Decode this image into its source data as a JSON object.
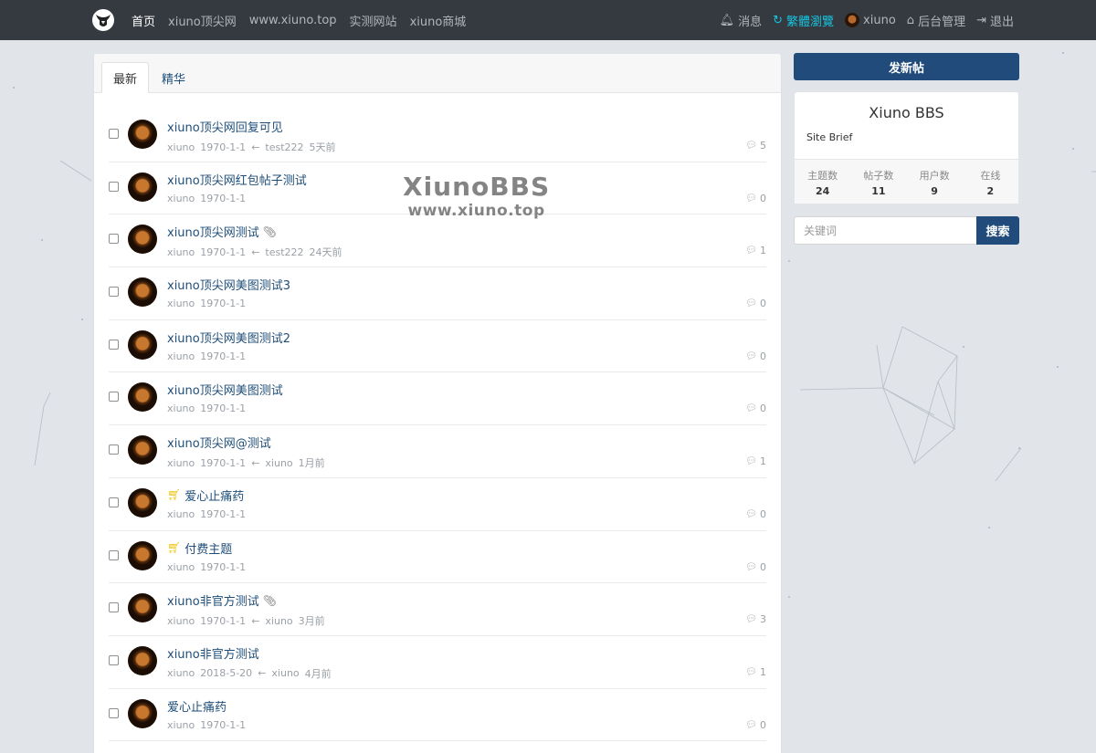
{
  "nav": {
    "left": [
      {
        "label": "首页",
        "active": true
      },
      {
        "label": "xiuno顶尖网",
        "active": false
      },
      {
        "label": "www.xiuno.top",
        "active": false
      },
      {
        "label": "实测网站",
        "active": false
      },
      {
        "label": "xiuno商城",
        "active": false
      }
    ],
    "messages": "消息",
    "traditional": "繁體瀏覽",
    "user": "xiuno",
    "admin": "后台管理",
    "logout": "退出"
  },
  "tabs": {
    "latest": "最新",
    "featured": "精华"
  },
  "watermark": {
    "title": "XiunoBBS",
    "url": "www.xiuno.top"
  },
  "threads": [
    {
      "title": "xiuno顶尖网回复可见",
      "author": "xiuno",
      "date": "1970-1-1",
      "last_user": "test222",
      "last_time": "5天前",
      "replies": "5",
      "attach": false,
      "paid": false
    },
    {
      "title": "xiuno顶尖网红包帖子测试",
      "author": "xiuno",
      "date": "1970-1-1",
      "last_user": "",
      "last_time": "",
      "replies": "0",
      "attach": false,
      "paid": false
    },
    {
      "title": "xiuno顶尖网测试",
      "author": "xiuno",
      "date": "1970-1-1",
      "last_user": "test222",
      "last_time": "24天前",
      "replies": "1",
      "attach": true,
      "paid": false
    },
    {
      "title": "xiuno顶尖网美图测试3",
      "author": "xiuno",
      "date": "1970-1-1",
      "last_user": "",
      "last_time": "",
      "replies": "0",
      "attach": false,
      "paid": false
    },
    {
      "title": "xiuno顶尖网美图测试2",
      "author": "xiuno",
      "date": "1970-1-1",
      "last_user": "",
      "last_time": "",
      "replies": "0",
      "attach": false,
      "paid": false
    },
    {
      "title": "xiuno顶尖网美图测试",
      "author": "xiuno",
      "date": "1970-1-1",
      "last_user": "",
      "last_time": "",
      "replies": "0",
      "attach": false,
      "paid": false
    },
    {
      "title": "xiuno顶尖网@测试",
      "author": "xiuno",
      "date": "1970-1-1",
      "last_user": "xiuno",
      "last_time": "1月前",
      "replies": "1",
      "attach": false,
      "paid": false
    },
    {
      "title": "爱心止痛药",
      "author": "xiuno",
      "date": "1970-1-1",
      "last_user": "",
      "last_time": "",
      "replies": "0",
      "attach": false,
      "paid": true
    },
    {
      "title": "付费主题",
      "author": "xiuno",
      "date": "1970-1-1",
      "last_user": "",
      "last_time": "",
      "replies": "0",
      "attach": false,
      "paid": true
    },
    {
      "title": "xiuno非官方测试",
      "author": "xiuno",
      "date": "1970-1-1",
      "last_user": "xiuno",
      "last_time": "3月前",
      "replies": "3",
      "attach": true,
      "paid": false
    },
    {
      "title": "xiuno非官方测试",
      "author": "xiuno",
      "date": "2018-5-20",
      "last_user": "xiuno",
      "last_time": "4月前",
      "replies": "1",
      "attach": false,
      "paid": false
    },
    {
      "title": "爱心止痛药",
      "author": "xiuno",
      "date": "1970-1-1",
      "last_user": "",
      "last_time": "",
      "replies": "0",
      "attach": false,
      "paid": false
    }
  ],
  "sidebar": {
    "new_post": "发新帖",
    "site_name": "Xiuno BBS",
    "site_brief": "Site Brief",
    "stats": [
      {
        "label": "主题数",
        "value": "24"
      },
      {
        "label": "帖子数",
        "value": "11"
      },
      {
        "label": "用户数",
        "value": "9"
      },
      {
        "label": "在线",
        "value": "2"
      }
    ],
    "search_placeholder": "关键词",
    "search_button": "搜索"
  },
  "colors": {
    "navbar": "#343a40",
    "primary": "#214b7b",
    "link": "#1f4e79",
    "accent": "#17c4df"
  }
}
